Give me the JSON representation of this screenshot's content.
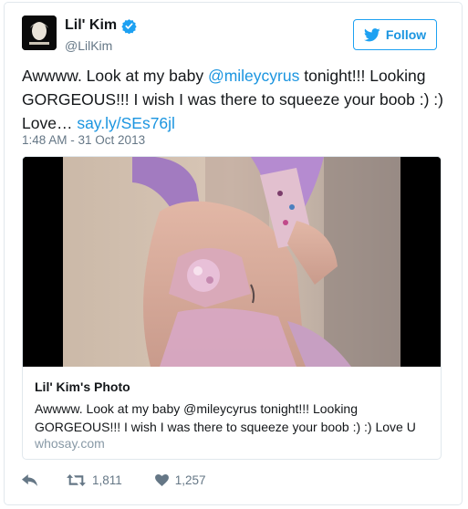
{
  "user": {
    "display_name": "Lil' Kim",
    "handle": "@LilKim",
    "verified": true
  },
  "follow_button": {
    "label": "Follow"
  },
  "tweet": {
    "text_before_mention": "Awwww. Look at my baby ",
    "mention": "@mileycyrus",
    "text_after_mention": " tonight!!! Looking GORGEOUS!!! I wish I was there to squeeze your boob :) :) Love… ",
    "link": "say.ly/SEs76jl",
    "timestamp": "1:48 AM - 31 Oct 2013"
  },
  "card": {
    "title": "Lil' Kim's Photo",
    "description": "Awwww. Look at my baby @mileycyrus tonight!!! Looking GORGEOUS!!! I wish I was there to squeeze your boob :) :) Love U",
    "domain": "whosay.com"
  },
  "actions": {
    "retweet_count": "1,811",
    "like_count": "1,257"
  },
  "colors": {
    "accent": "#1da1f2",
    "link": "#1b95e0",
    "muted": "#657786",
    "border": "#e1e8ed"
  },
  "icons": [
    "verified-badge-icon",
    "twitter-bird-icon",
    "reply-icon",
    "retweet-icon",
    "heart-icon"
  ]
}
